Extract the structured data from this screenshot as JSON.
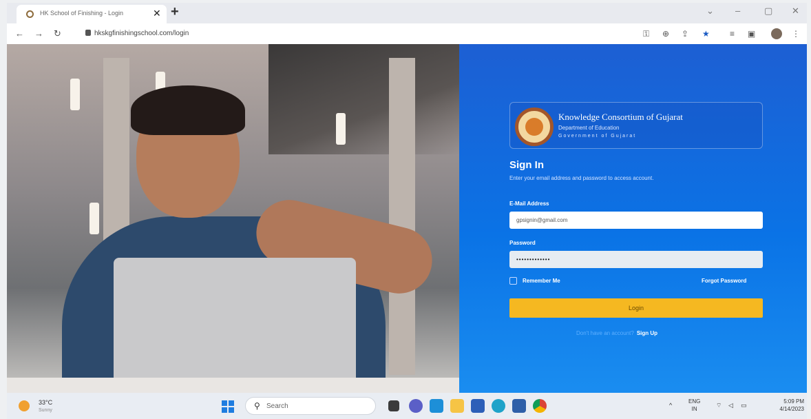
{
  "browser": {
    "tab_title": "HK School of Finishing - Login",
    "tab_close": "✕",
    "new_tab": "+",
    "url": "hkskgfinishingschool.com/login",
    "nav": {
      "back": "←",
      "forward": "→",
      "reload": "↻"
    },
    "window_controls": {
      "collapse": "⌄",
      "minimize": "–",
      "restore": "▢",
      "close": "✕"
    },
    "toolbar_icons": [
      "key-icon",
      "zoom-icon",
      "share-icon",
      "star-icon",
      "extensions-icon",
      "sidebar-icon",
      "profile-icon",
      "menu-icon"
    ]
  },
  "brand": {
    "title": "Knowledge Consortium of Gujarat",
    "subtitle": "Department of Education",
    "gov": "Government of Gujarat"
  },
  "signin": {
    "title": "Sign In",
    "subtitle": "Enter your email address and password to access account."
  },
  "form": {
    "email_label": "E-Mail Address",
    "email_value": "gpsignin@gmail.com",
    "password_label": "Password",
    "password_value": "•••••••••••••",
    "remember_label": "Remember Me",
    "forgot_label": "Forgot Password",
    "login_label": "Login",
    "signup_prompt": "Don't have an account?",
    "signup_link": "Sign Up"
  },
  "taskbar": {
    "temp": "33°C",
    "condition": "Sunny",
    "search_placeholder": "Search",
    "lang_top": "ENG",
    "lang_bottom": "IN",
    "time": "5:09 PM",
    "date": "4/14/2023",
    "tray_chevron": "^",
    "apps": [
      "file-explorer-icon",
      "chat-icon",
      "widgets-icon",
      "folder-icon",
      "mail-icon",
      "edge-icon",
      "store-icon",
      "chrome-icon"
    ]
  },
  "colors": {
    "panel_blue": "#0a73e6",
    "login_button": "#f5b821"
  }
}
